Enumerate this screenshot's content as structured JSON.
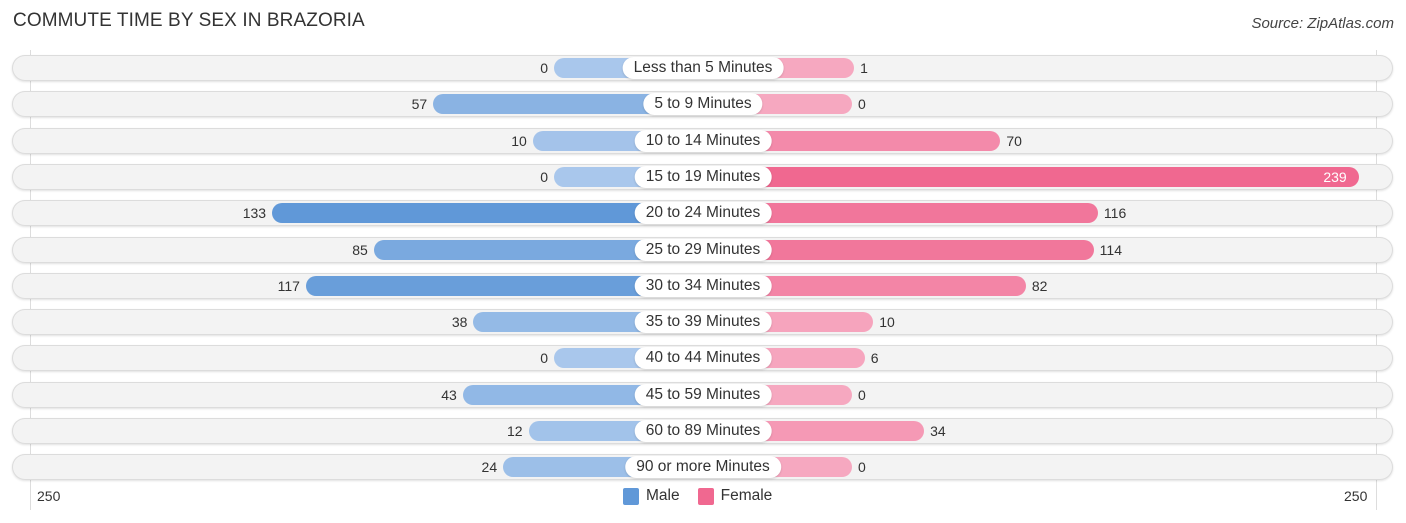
{
  "header": {
    "title": "COMMUTE TIME BY SEX IN BRAZORIA",
    "source": "Source: ZipAtlas.com"
  },
  "colors": {
    "male_strong": "#6098d8",
    "male_light": "#a9c7ec",
    "female_strong": "#f06890",
    "female_light": "#f6a8c0",
    "row_bg": "#f3f3f3"
  },
  "chart_data": {
    "type": "bar",
    "orientation": "horizontal-diverging",
    "title": "COMMUTE TIME BY SEX IN BRAZORIA",
    "categories": [
      "Less than 5 Minutes",
      "5 to 9 Minutes",
      "10 to 14 Minutes",
      "15 to 19 Minutes",
      "20 to 24 Minutes",
      "25 to 29 Minutes",
      "30 to 34 Minutes",
      "35 to 39 Minutes",
      "40 to 44 Minutes",
      "45 to 59 Minutes",
      "60 to 89 Minutes",
      "90 or more Minutes"
    ],
    "series": [
      {
        "name": "Male",
        "values": [
          0,
          57,
          10,
          0,
          133,
          85,
          117,
          38,
          0,
          43,
          12,
          24
        ]
      },
      {
        "name": "Female",
        "values": [
          1,
          0,
          70,
          239,
          116,
          114,
          82,
          10,
          6,
          0,
          34,
          0
        ]
      }
    ],
    "axis": {
      "left_label": "250",
      "right_label": "250",
      "range": [
        250,
        250
      ]
    },
    "legend": {
      "placement": "bottom-center",
      "items": [
        "Male",
        "Female"
      ]
    },
    "grid": false
  }
}
